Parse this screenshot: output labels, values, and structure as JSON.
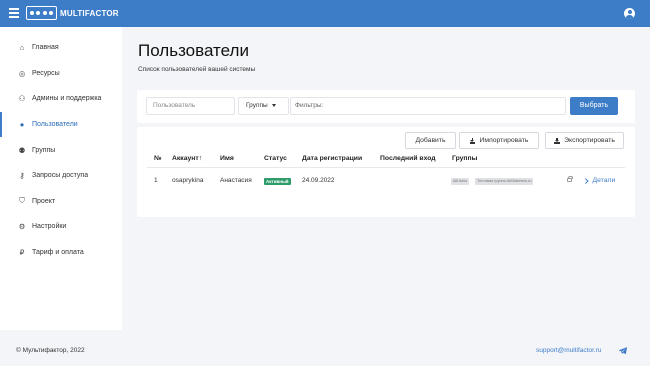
{
  "app": {
    "name": "MULTIFACTOR"
  },
  "sidebar": {
    "items": [
      {
        "label": "Главная",
        "icon": "home-icon",
        "glyph": "⌂"
      },
      {
        "label": "Ресурсы",
        "icon": "globe-icon",
        "glyph": "◎"
      },
      {
        "label": "Админы и поддержка",
        "icon": "user-gear-icon",
        "glyph": "⚇"
      },
      {
        "label": "Пользователи",
        "icon": "user-icon",
        "glyph": "●"
      },
      {
        "label": "Группы",
        "icon": "users-icon",
        "glyph": "⚉"
      },
      {
        "label": "Запросы доступа",
        "icon": "key-icon",
        "glyph": "⚷"
      },
      {
        "label": "Проект",
        "icon": "shield-icon",
        "glyph": "⛉"
      },
      {
        "label": "Настройки",
        "icon": "gear-icon",
        "glyph": "⚙"
      },
      {
        "label": "Тариф и оплата",
        "icon": "ruble-icon",
        "glyph": "₽"
      }
    ]
  },
  "main": {
    "title": "Пользователи",
    "subtitle": "Список пользователей вашей системы"
  },
  "filters": {
    "user_placeholder": "Пользователь",
    "groups_label": "Группы",
    "filters_placeholder": "Фильтры:",
    "select_button": "Выбрать"
  },
  "actions": {
    "add": "Добавить",
    "import": "Импортировать",
    "export": "Экспортировать"
  },
  "table": {
    "headers": [
      "№",
      "Аккаунт↑",
      "Имя",
      "Статус",
      "Дата регистрации",
      "Последний вход",
      "Группы"
    ],
    "rows": [
      {
        "num": "1",
        "account": "osaprykina",
        "name": "Анастасия",
        "status": "Активный",
        "registered": "24.09.2022",
        "last_login": "",
        "groups": [
          "AllUsers",
          "Тестовая группа AirMaketers.ru"
        ],
        "details": "Детали"
      }
    ]
  },
  "footer": {
    "copyright": "© Мультифактор, 2022",
    "support": "support@multifactor.ru"
  },
  "colors": {
    "brand": "#3d7dc7",
    "status_active": "#2e9b6b"
  }
}
